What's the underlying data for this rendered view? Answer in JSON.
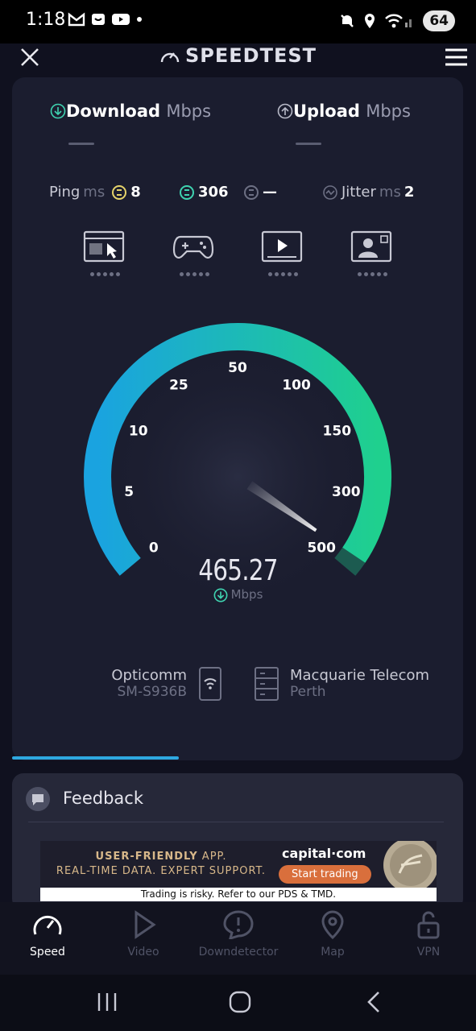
{
  "status_bar": {
    "time": "1:18",
    "battery": "64"
  },
  "header": {
    "title": "SPEEDTEST"
  },
  "tabs": {
    "download_label": "Download",
    "download_unit": "Mbps",
    "upload_label": "Upload",
    "upload_unit": "Mbps"
  },
  "metrics": {
    "ping_label": "Ping",
    "ping_unit": "ms",
    "ping_idle": "8",
    "ping_download": "306",
    "ping_upload": "—",
    "jitter_label": "Jitter",
    "jitter_unit": "ms",
    "jitter_value": "2"
  },
  "gauge": {
    "ticks": [
      "0",
      "5",
      "10",
      "25",
      "50",
      "100",
      "150",
      "300",
      "500"
    ],
    "speed": "465.27",
    "unit": "Mbps",
    "needle_value": 465.27,
    "colors": {
      "start": "#1aa3e0",
      "end": "#1fd08e"
    }
  },
  "connection": {
    "provider_name": "Opticomm",
    "device": "SM-S936B",
    "server_name": "Macquarie Telecom",
    "server_location": "Perth"
  },
  "test_progress": 0.37,
  "feedback": {
    "title": "Feedback"
  },
  "ad": {
    "line1a": "USER-FRIENDLY",
    "line1b": " APP.",
    "line2": "REAL-TIME DATA. EXPERT SUPPORT.",
    "brand": "capital·com",
    "cta": "Start trading",
    "disclaimer": "Trading is risky. Refer to our PDS & TMD."
  },
  "bottom_nav": [
    {
      "label": "Speed",
      "icon": "speedometer-icon"
    },
    {
      "label": "Video",
      "icon": "play-icon"
    },
    {
      "label": "Downdetector",
      "icon": "alert-icon"
    },
    {
      "label": "Map",
      "icon": "map-pin-icon"
    },
    {
      "label": "VPN",
      "icon": "unlock-icon"
    }
  ]
}
